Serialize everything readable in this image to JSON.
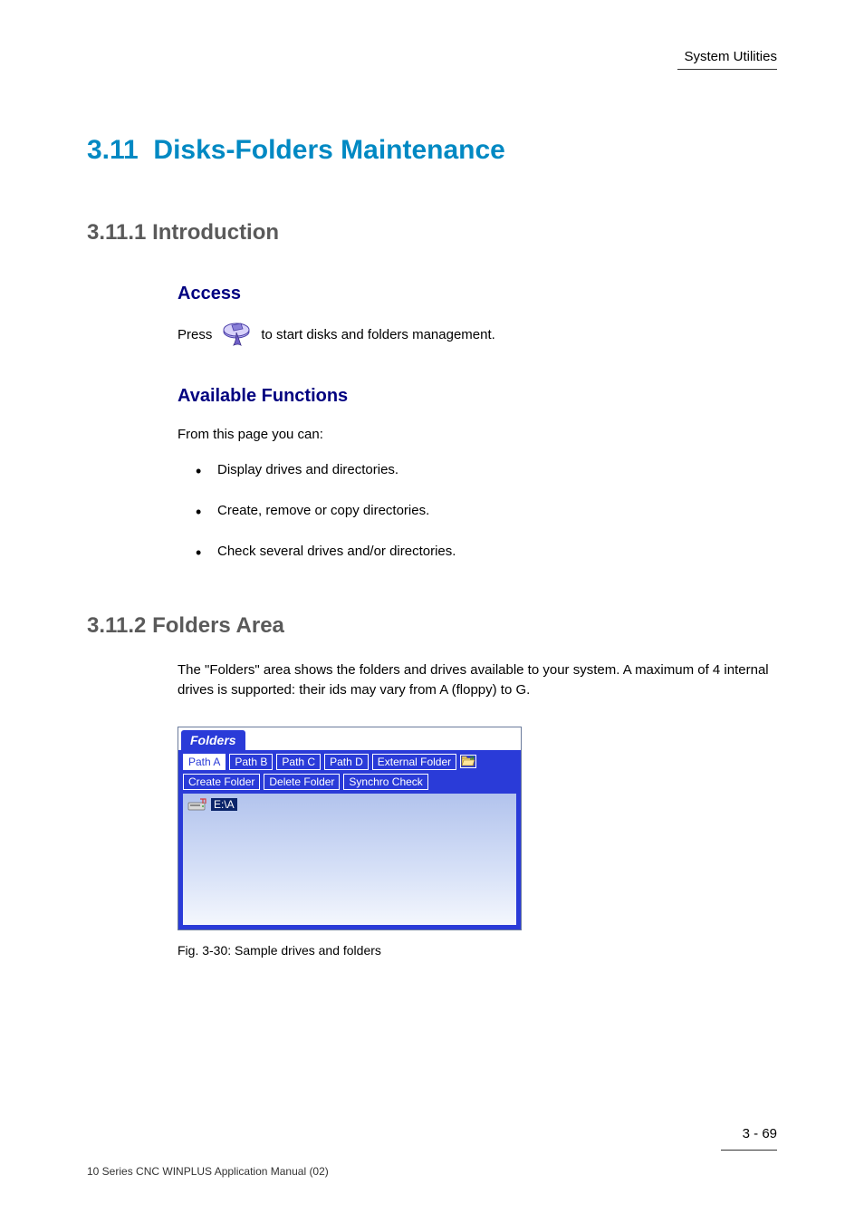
{
  "header": {
    "right_text": "System Utilities"
  },
  "section": {
    "number": "3.11",
    "title": "Disks-Folders  Maintenance"
  },
  "sub1": {
    "number": "3.11.1",
    "title": "Introduction"
  },
  "access": {
    "heading": "Access",
    "line_before": "Press",
    "line_after": "to start disks and folders management."
  },
  "functions": {
    "heading": "Available  Functions",
    "intro": "From this page you can:",
    "items": [
      "Display drives and directories.",
      "Create, remove or copy directories.",
      "Check several drives and/or directories."
    ]
  },
  "sub2": {
    "number": "3.11.2",
    "title": "Folders  Area"
  },
  "folders_area": {
    "intro": "The \"Folders\" area shows the folders and drives available to your system. A maximum of 4 internal drives is supported: their ids may vary from A (floppy) to G."
  },
  "panel": {
    "tab_label": "Folders",
    "row1": {
      "path_a": "Path A",
      "path_b": "Path B",
      "path_c": "Path C",
      "path_d": "Path D",
      "external_folder": "External Folder"
    },
    "row2": {
      "create": "Create Folder",
      "delete": "Delete Folder",
      "synchro": "Synchro Check"
    },
    "drive_label": "E:\\A"
  },
  "figure": {
    "caption": "Fig. 3-30:  Sample drives and folders"
  },
  "footer": {
    "page": "3 - 69",
    "copyright": "10 Series CNC  WINPLUS Application Manual (02)"
  }
}
